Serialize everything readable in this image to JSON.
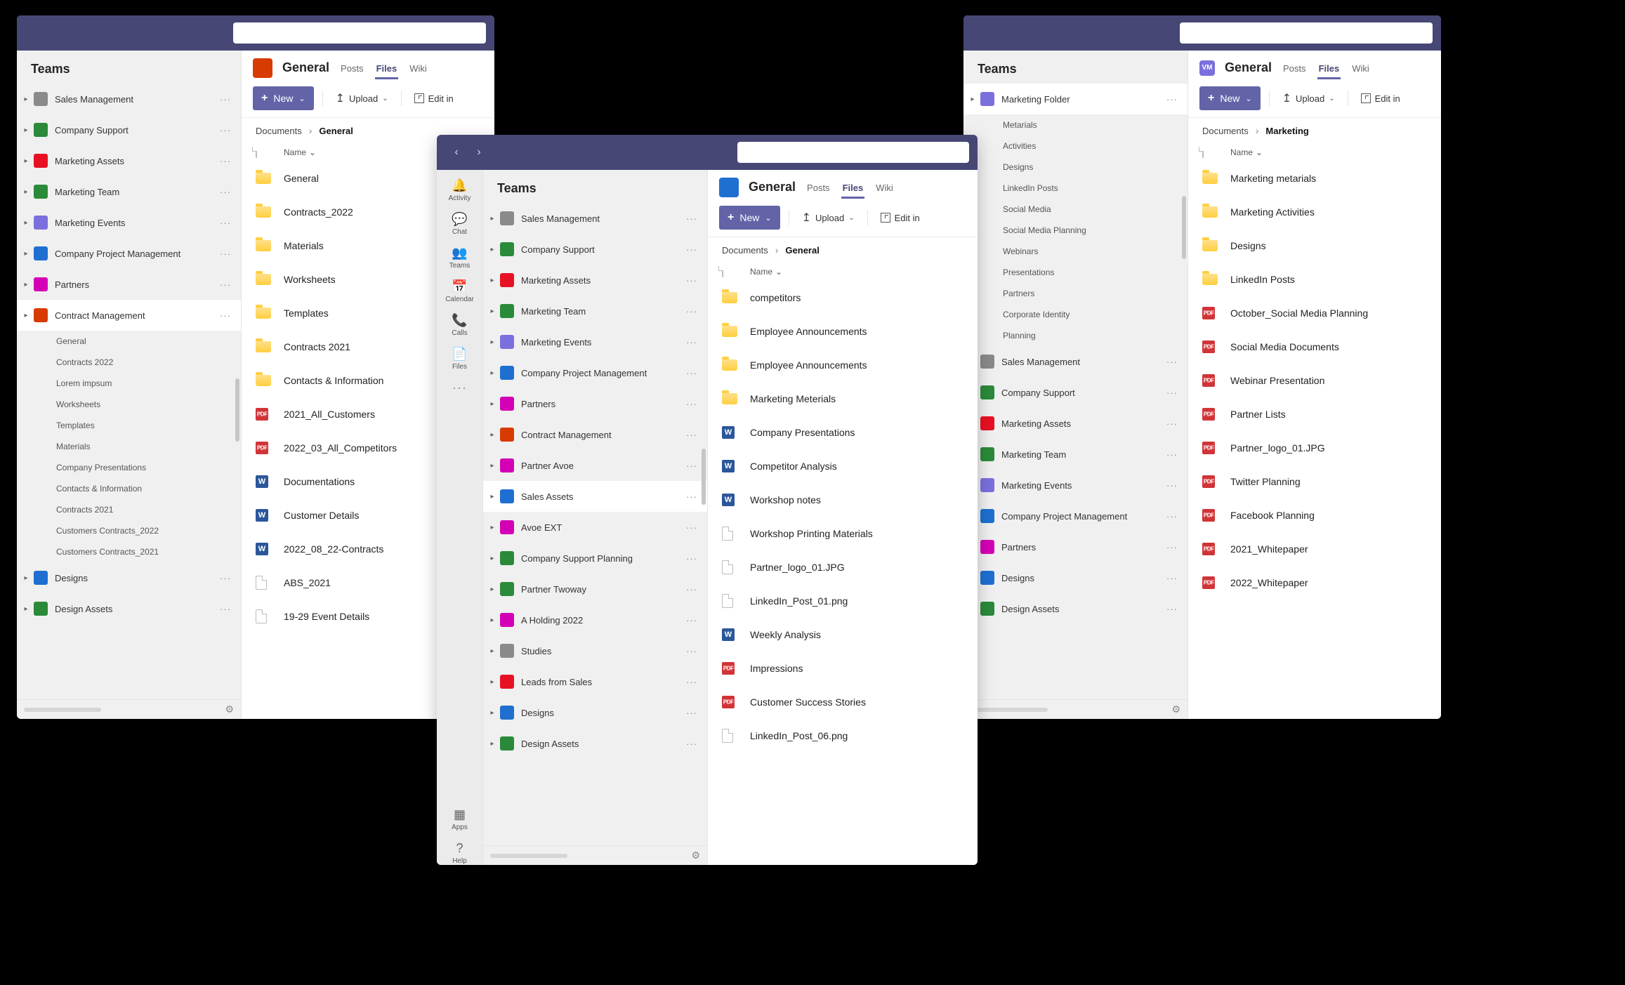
{
  "common": {
    "sidebar_title": "Teams",
    "channel_title": "General",
    "tabs": {
      "posts": "Posts",
      "files": "Files",
      "wiki": "Wiki"
    },
    "toolbar": {
      "new": "New",
      "upload": "Upload",
      "edit": "Edit in"
    },
    "crumbs": {
      "root": "Documents",
      "current": "General"
    },
    "list_header": "Name",
    "apprail": {
      "activity": "Activity",
      "chat": "Chat",
      "teams": "Teams",
      "calendar": "Calendar",
      "calls": "Calls",
      "files": "Files",
      "apps": "Apps",
      "help": "Help"
    }
  },
  "left": {
    "team_tile_color": "#d83b01",
    "teams": [
      {
        "name": "Sales Management",
        "color": "#8a8a8a"
      },
      {
        "name": "Company Support",
        "color": "#2a8a3a"
      },
      {
        "name": "Marketing Assets",
        "color": "#e81123"
      },
      {
        "name": "Marketing Team",
        "color": "#2a8a3a"
      },
      {
        "name": "Marketing Events",
        "color": "#7b6fdd"
      },
      {
        "name": "Company Project Management",
        "color": "#1f6fd0"
      },
      {
        "name": "Partners",
        "color": "#d400b6"
      },
      {
        "name": "Contract Management",
        "color": "#d83b01",
        "expanded": true,
        "children": [
          "General",
          "Contracts 2022",
          "Lorem impsum",
          "Worksheets",
          "Templates",
          "Materials",
          "Company Presentations",
          "Contacts & Information",
          "Contracts 2021",
          "Customers Contracts_2022",
          "Customers Contracts_2021"
        ]
      },
      {
        "name": "Designs",
        "color": "#1f6fd0"
      },
      {
        "name": "Design Assets",
        "color": "#2a8a3a"
      }
    ],
    "files": [
      {
        "icon": "folder",
        "name": "General"
      },
      {
        "icon": "folder",
        "name": "Contracts_2022"
      },
      {
        "icon": "folder",
        "name": "Materials"
      },
      {
        "icon": "folder",
        "name": "Worksheets"
      },
      {
        "icon": "folder",
        "name": "Templates"
      },
      {
        "icon": "folder",
        "name": "Contracts 2021"
      },
      {
        "icon": "folder",
        "name": "Contacts & Information"
      },
      {
        "icon": "pdf",
        "name": "2021_All_Customers"
      },
      {
        "icon": "pdf",
        "name": "2022_03_All_Competitors"
      },
      {
        "icon": "word",
        "name": "Documentations"
      },
      {
        "icon": "word",
        "name": "Customer Details"
      },
      {
        "icon": "word",
        "name": "2022_08_22-Contracts"
      },
      {
        "icon": "blank",
        "name": "ABS_2021"
      },
      {
        "icon": "blank",
        "name": "19-29 Event Details"
      }
    ]
  },
  "center": {
    "team_tile_color": "#1f6fd0",
    "teams": [
      {
        "name": "Sales Management",
        "color": "#8a8a8a"
      },
      {
        "name": "Company Support",
        "color": "#2a8a3a"
      },
      {
        "name": "Marketing Assets",
        "color": "#e81123"
      },
      {
        "name": "Marketing Team",
        "color": "#2a8a3a"
      },
      {
        "name": "Marketing Events",
        "color": "#7b6fdd"
      },
      {
        "name": "Company Project Management",
        "color": "#1f6fd0"
      },
      {
        "name": "Partners",
        "color": "#d400b6"
      },
      {
        "name": "Contract Management",
        "color": "#d83b01"
      },
      {
        "name": "Partner  Avoe",
        "color": "#d400b6"
      },
      {
        "name": "Sales Assets",
        "color": "#1f6fd0",
        "selected": true
      },
      {
        "name": "Avoe EXT",
        "color": "#d400b6"
      },
      {
        "name": "Company Support Planning",
        "color": "#2a8a3a"
      },
      {
        "name": "Partner Twoway",
        "color": "#2a8a3a"
      },
      {
        "name": "A Holding 2022",
        "color": "#d400b6"
      },
      {
        "name": "Studies",
        "color": "#8a8a8a"
      },
      {
        "name": "Leads from Sales",
        "color": "#e81123"
      },
      {
        "name": "Designs",
        "color": "#1f6fd0"
      },
      {
        "name": "Design Assets",
        "color": "#2a8a3a"
      }
    ],
    "files": [
      {
        "icon": "folder",
        "name": "competitors"
      },
      {
        "icon": "folder",
        "name": "Employee Announcements"
      },
      {
        "icon": "folder",
        "name": "Employee Announcements"
      },
      {
        "icon": "folder",
        "name": "Marketing Meterials"
      },
      {
        "icon": "word",
        "name": "Company Presentations"
      },
      {
        "icon": "word",
        "name": "Competitor Analysis"
      },
      {
        "icon": "word",
        "name": "Workshop notes"
      },
      {
        "icon": "blank",
        "name": "Workshop Printing Materials"
      },
      {
        "icon": "blank",
        "name": "Partner_logo_01.JPG"
      },
      {
        "icon": "blank",
        "name": "LinkedIn_Post_01.png"
      },
      {
        "icon": "word",
        "name": "Weekly Analysis"
      },
      {
        "icon": "pdf",
        "name": "Impressions"
      },
      {
        "icon": "pdf",
        "name": "Customer Success Stories"
      },
      {
        "icon": "blank",
        "name": "LinkedIn_Post_06.png"
      }
    ]
  },
  "right": {
    "team_tile_color": "#7b6fdd",
    "team_tile_initials": "VM",
    "teams": [
      {
        "name": "Marketing Folder",
        "color": "#7b6fdd",
        "expanded": true,
        "children": [
          "Metarials",
          "Activities",
          "Designs",
          "LinkedIn Posts",
          "Social Media",
          "Social Media Planning",
          "Webinars",
          "Presentations",
          "Partners",
          "Corporate Identity",
          "Planning"
        ]
      },
      {
        "name": "Sales Management",
        "color": "#8a8a8a"
      },
      {
        "name": "Company Support",
        "color": "#2a8a3a"
      },
      {
        "name": "Marketing Assets",
        "color": "#e81123"
      },
      {
        "name": "Marketing Team",
        "color": "#2a8a3a"
      },
      {
        "name": "Marketing Events",
        "color": "#7b6fdd"
      },
      {
        "name": "Company Project Management",
        "color": "#1f6fd0"
      },
      {
        "name": "Partners",
        "color": "#d400b6"
      },
      {
        "name": "Designs",
        "color": "#1f6fd0"
      },
      {
        "name": "Design Assets",
        "color": "#2a8a3a"
      }
    ],
    "crumbs_current": "Marketing",
    "files": [
      {
        "icon": "folder",
        "name": "Marketing metarials"
      },
      {
        "icon": "folder",
        "name": "Marketing Activities"
      },
      {
        "icon": "folder",
        "name": "Designs"
      },
      {
        "icon": "folder",
        "name": "LinkedIn Posts"
      },
      {
        "icon": "pdf",
        "name": "October_Social Media Planning"
      },
      {
        "icon": "pdf",
        "name": "Social Media Documents"
      },
      {
        "icon": "pdf",
        "name": "Webinar Presentation"
      },
      {
        "icon": "pdf",
        "name": "Partner Lists"
      },
      {
        "icon": "pdf",
        "name": "Partner_logo_01.JPG"
      },
      {
        "icon": "pdf",
        "name": "Twitter Planning"
      },
      {
        "icon": "pdf",
        "name": "Facebook Planning"
      },
      {
        "icon": "pdf",
        "name": "2021_Whitepaper"
      },
      {
        "icon": "pdf",
        "name": "2022_Whitepaper"
      }
    ]
  }
}
